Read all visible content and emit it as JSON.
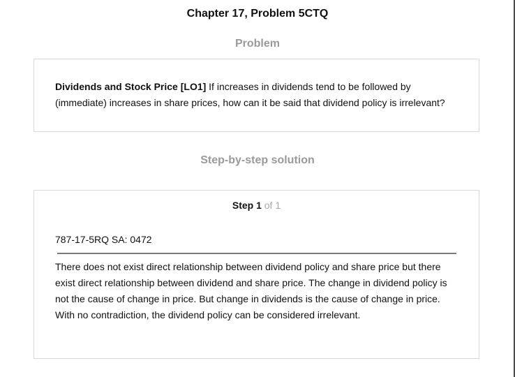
{
  "page": {
    "title": "Chapter 17, Problem 5CTQ"
  },
  "problem": {
    "heading": "Problem",
    "bold_lead": "Dividends and Stock Price [LO1]",
    "text": " If increases in dividends tend to be followed by (immediate) increases in share prices, how can it be said that dividend policy is irrelevant?"
  },
  "solution": {
    "heading": "Step-by-step solution",
    "step_label": "Step 1",
    "step_of": " of 1",
    "code": "787-17-5RQ SA: 0472",
    "text": "There does not exist direct relationship between dividend policy and share price but there exist direct relationship between dividend and share price. The change in dividend policy is not the cause of change in price. But change in dividends is the cause of change in price. With no contradiction, the dividend policy can be considered irrelevant."
  }
}
